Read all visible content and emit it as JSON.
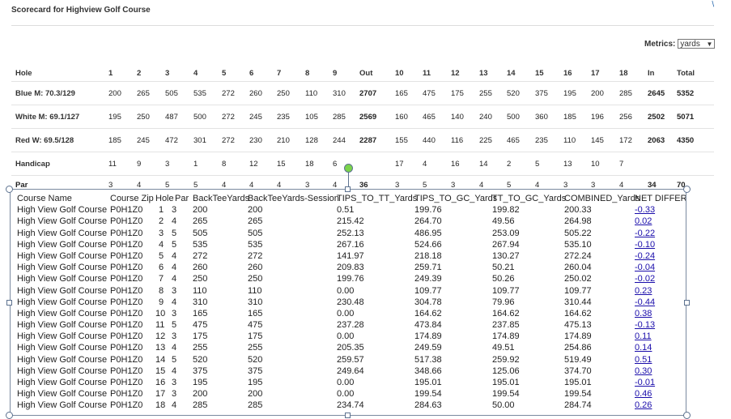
{
  "title": "Scorecard for Highview Golf Course",
  "metrics": {
    "label": "Metrics:",
    "selected": "yards"
  },
  "scorecard": {
    "header": [
      "Hole",
      "1",
      "2",
      "3",
      "4",
      "5",
      "6",
      "7",
      "8",
      "9",
      "Out",
      "10",
      "11",
      "12",
      "13",
      "14",
      "15",
      "16",
      "17",
      "18",
      "In",
      "Total"
    ],
    "rows": [
      [
        "Blue M: 70.3/129",
        "200",
        "265",
        "505",
        "535",
        "272",
        "260",
        "250",
        "110",
        "310",
        "2707",
        "165",
        "475",
        "175",
        "255",
        "520",
        "375",
        "195",
        "200",
        "285",
        "2645",
        "5352"
      ],
      [
        "White M: 69.1/127",
        "195",
        "250",
        "487",
        "500",
        "272",
        "245",
        "235",
        "105",
        "285",
        "2569",
        "160",
        "465",
        "140",
        "240",
        "500",
        "360",
        "185",
        "196",
        "256",
        "2502",
        "5071"
      ],
      [
        "Red W: 69.5/128",
        "185",
        "245",
        "472",
        "301",
        "272",
        "230",
        "210",
        "128",
        "244",
        "2287",
        "155",
        "440",
        "116",
        "225",
        "465",
        "235",
        "110",
        "145",
        "172",
        "2063",
        "4350"
      ],
      [
        "Handicap",
        "11",
        "9",
        "3",
        "1",
        "8",
        "12",
        "15",
        "18",
        "6",
        "",
        "17",
        "4",
        "16",
        "14",
        "2",
        "5",
        "13",
        "10",
        "7",
        "",
        ""
      ],
      [
        "Par",
        "3",
        "4",
        "5",
        "5",
        "4",
        "4",
        "4",
        "3",
        "4",
        "36",
        "3",
        "5",
        "3",
        "4",
        "5",
        "4",
        "3",
        "3",
        "4",
        "34",
        "70"
      ]
    ]
  },
  "overlay": {
    "columns": [
      "Course Name",
      "Course Zip",
      "Hole",
      "Par",
      "BackTeeYards",
      "BackTeeYards-Session",
      "TIPS_TO_TT_Yards",
      "TIPS_TO_GC_Yards",
      "TT_TO_GC_Yards",
      "COMBINED_Yards",
      "NET DIFFERENCE"
    ],
    "rows": [
      [
        "High View Golf Course",
        "P0H1Z0",
        "1",
        "3",
        "200",
        "200",
        "0.51",
        "199.76",
        "199.82",
        "200.33",
        "-0.33"
      ],
      [
        "High View Golf Course",
        "P0H1Z0",
        "2",
        "4",
        "265",
        "265",
        "215.42",
        "264.70",
        "49.56",
        "264.98",
        "0.02"
      ],
      [
        "High View Golf Course",
        "P0H1Z0",
        "3",
        "5",
        "505",
        "505",
        "252.13",
        "486.95",
        "253.09",
        "505.22",
        "-0.22"
      ],
      [
        "High View Golf Course",
        "P0H1Z0",
        "4",
        "5",
        "535",
        "535",
        "267.16",
        "524.66",
        "267.94",
        "535.10",
        "-0.10"
      ],
      [
        "High View Golf Course",
        "P0H1Z0",
        "5",
        "4",
        "272",
        "272",
        "141.97",
        "218.18",
        "130.27",
        "272.24",
        "-0.24"
      ],
      [
        "High View Golf Course",
        "P0H1Z0",
        "6",
        "4",
        "260",
        "260",
        "209.83",
        "259.71",
        "50.21",
        "260.04",
        "-0.04"
      ],
      [
        "High View Golf Course",
        "P0H1Z0",
        "7",
        "4",
        "250",
        "250",
        "199.76",
        "249.39",
        "50.26",
        "250.02",
        "-0.02"
      ],
      [
        "High View Golf Course",
        "P0H1Z0",
        "8",
        "3",
        "110",
        "110",
        "0.00",
        "109.77",
        "109.77",
        "109.77",
        "0.23"
      ],
      [
        "High View Golf Course",
        "P0H1Z0",
        "9",
        "4",
        "310",
        "310",
        "230.48",
        "304.78",
        "79.96",
        "310.44",
        "-0.44"
      ],
      [
        "High View Golf Course",
        "P0H1Z0",
        "10",
        "3",
        "165",
        "165",
        "0.00",
        "164.62",
        "164.62",
        "164.62",
        "0.38"
      ],
      [
        "High View Golf Course",
        "P0H1Z0",
        "11",
        "5",
        "475",
        "475",
        "237.28",
        "473.84",
        "237.85",
        "475.13",
        "-0.13"
      ],
      [
        "High View Golf Course",
        "P0H1Z0",
        "12",
        "3",
        "175",
        "175",
        "0.00",
        "174.89",
        "174.89",
        "174.89",
        "0.11"
      ],
      [
        "High View Golf Course",
        "P0H1Z0",
        "13",
        "4",
        "255",
        "255",
        "205.35",
        "249.59",
        "49.51",
        "254.86",
        "0.14"
      ],
      [
        "High View Golf Course",
        "P0H1Z0",
        "14",
        "5",
        "520",
        "520",
        "259.57",
        "517.38",
        "259.92",
        "519.49",
        "0.51"
      ],
      [
        "High View Golf Course",
        "P0H1Z0",
        "15",
        "4",
        "375",
        "375",
        "249.64",
        "348.66",
        "125.06",
        "374.70",
        "0.30"
      ],
      [
        "High View Golf Course",
        "P0H1Z0",
        "16",
        "3",
        "195",
        "195",
        "0.00",
        "195.01",
        "195.01",
        "195.01",
        "-0.01"
      ],
      [
        "High View Golf Course",
        "P0H1Z0",
        "17",
        "3",
        "200",
        "200",
        "0.00",
        "199.54",
        "199.54",
        "199.54",
        "0.46"
      ],
      [
        "High View Golf Course",
        "P0H1Z0",
        "18",
        "4",
        "285",
        "285",
        "234.74",
        "284.63",
        "50.00",
        "284.74",
        "0.26"
      ]
    ]
  }
}
